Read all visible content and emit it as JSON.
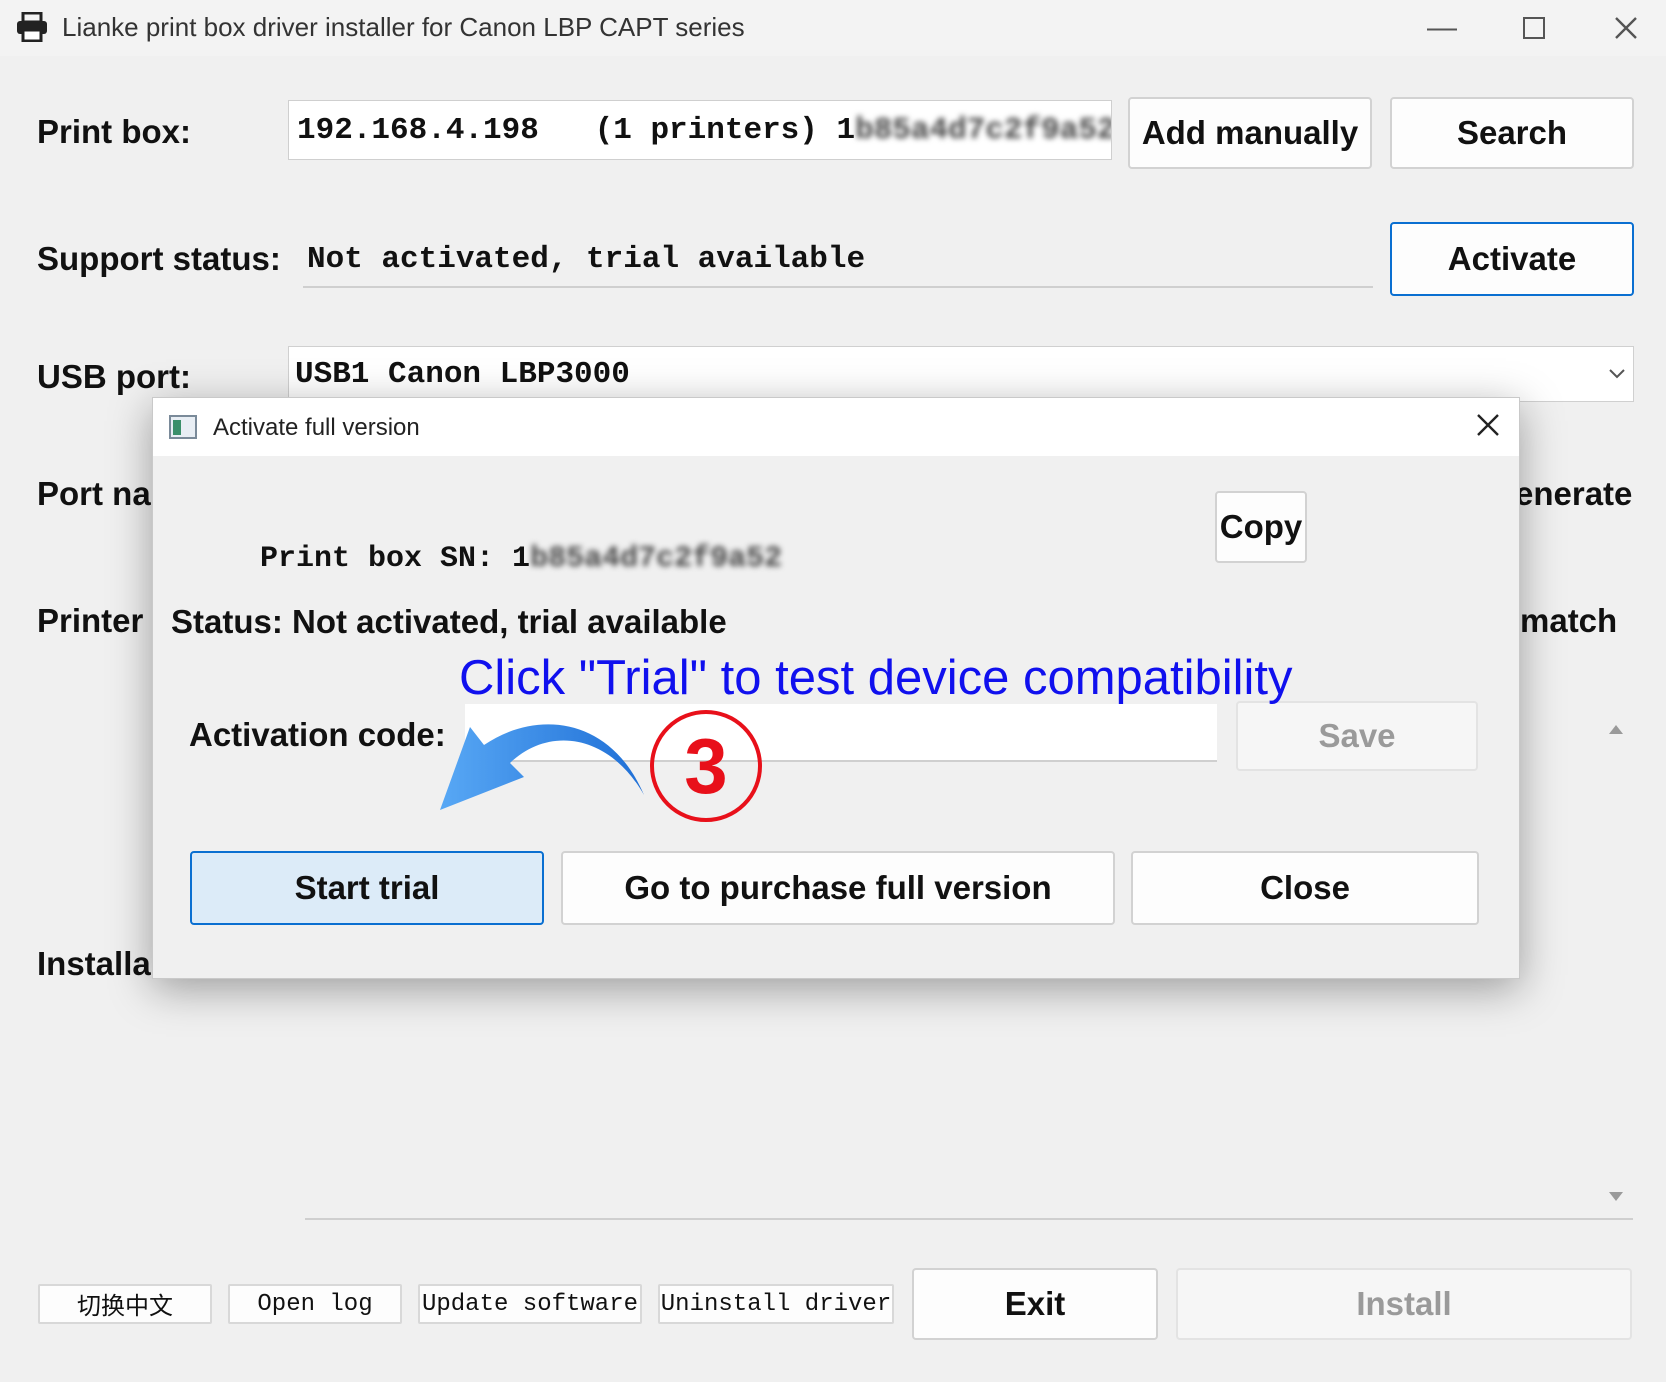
{
  "window": {
    "title": "Lianke print box driver installer for Canon LBP CAPT series",
    "minimize_icon": "minimize-icon",
    "maximize_icon": "maximize-icon",
    "close_icon": "close-icon"
  },
  "main": {
    "print_box_label": "Print box:",
    "print_box_value": "192.168.4.198   (1 printers) 1",
    "print_box_sn_blurred": "b85a4d7c2f9a52",
    "add_manually_label": "Add manually",
    "search_label": "Search",
    "support_status_label": "Support status:",
    "support_status_value": "Not activated, trial available",
    "activate_label": "Activate",
    "usb_port_label": "USB port:",
    "usb_port_value": "USB1 Canon LBP3000",
    "port_name_label_partial": "Port na",
    "generate_partial": "enerate",
    "printer_label_partial": "Printer",
    "match_partial": "match",
    "install_label_partial": "Installa"
  },
  "dialog": {
    "title": "Activate full version",
    "sn_label": "Print box SN: 1",
    "sn_blurred": "b85a4d7c2f9a52",
    "copy_label": "Copy",
    "status_text": "Status: Not activated, trial available",
    "activation_code_label": "Activation code:",
    "activation_code_value": "",
    "save_label": "Save",
    "start_trial_label": "Start trial",
    "purchase_label": "Go to purchase full version",
    "close_label": "Close"
  },
  "annotation": {
    "text": "Click \"Trial\" to test device compatibility",
    "step_number": "3",
    "text_color": "#1010ee",
    "step_color": "#e8101a"
  },
  "footer": {
    "switch_chinese_label": "切换中文",
    "open_log_label": "Open log",
    "update_software_label": "Update software",
    "uninstall_driver_label": "Uninstall driver",
    "exit_label": "Exit",
    "install_label": "Install"
  }
}
